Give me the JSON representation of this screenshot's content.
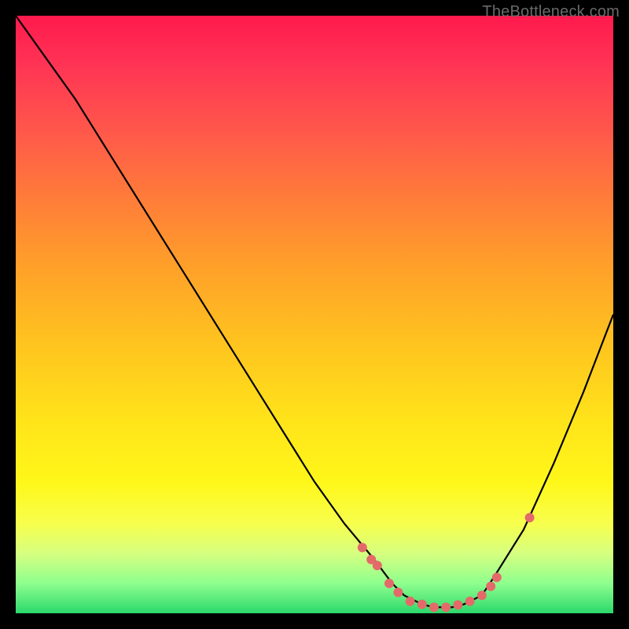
{
  "watermark": "TheBottleneck.com",
  "chart_data": {
    "type": "line",
    "title": "",
    "xlabel": "",
    "ylabel": "",
    "xlim": [
      0,
      100
    ],
    "ylim": [
      0,
      100
    ],
    "series": [
      {
        "name": "bottleneck-curve",
        "x": [
          0,
          5,
          10,
          15,
          20,
          25,
          30,
          35,
          40,
          45,
          50,
          55,
          60,
          63,
          65,
          68,
          70,
          73,
          75,
          78,
          80,
          85,
          90,
          95,
          100
        ],
        "y": [
          100,
          93,
          86,
          78,
          70,
          62,
          54,
          46,
          38,
          30,
          22,
          15,
          9,
          5,
          3,
          1.5,
          1,
          1,
          1.5,
          3,
          6,
          14,
          25,
          37,
          50
        ]
      }
    ],
    "markers": {
      "name": "highlight-dots",
      "x": [
        58,
        59.5,
        60.5,
        62.5,
        64,
        66,
        68,
        70,
        72,
        74,
        76,
        78,
        79.5,
        80.5,
        86
      ],
      "y": [
        11,
        9,
        8,
        5,
        3.5,
        2,
        1.5,
        1,
        1,
        1.4,
        2,
        3,
        4.5,
        6,
        16
      ]
    },
    "background_gradient": [
      "#ff1a4d",
      "#ffe41a",
      "#2bd96b"
    ]
  }
}
